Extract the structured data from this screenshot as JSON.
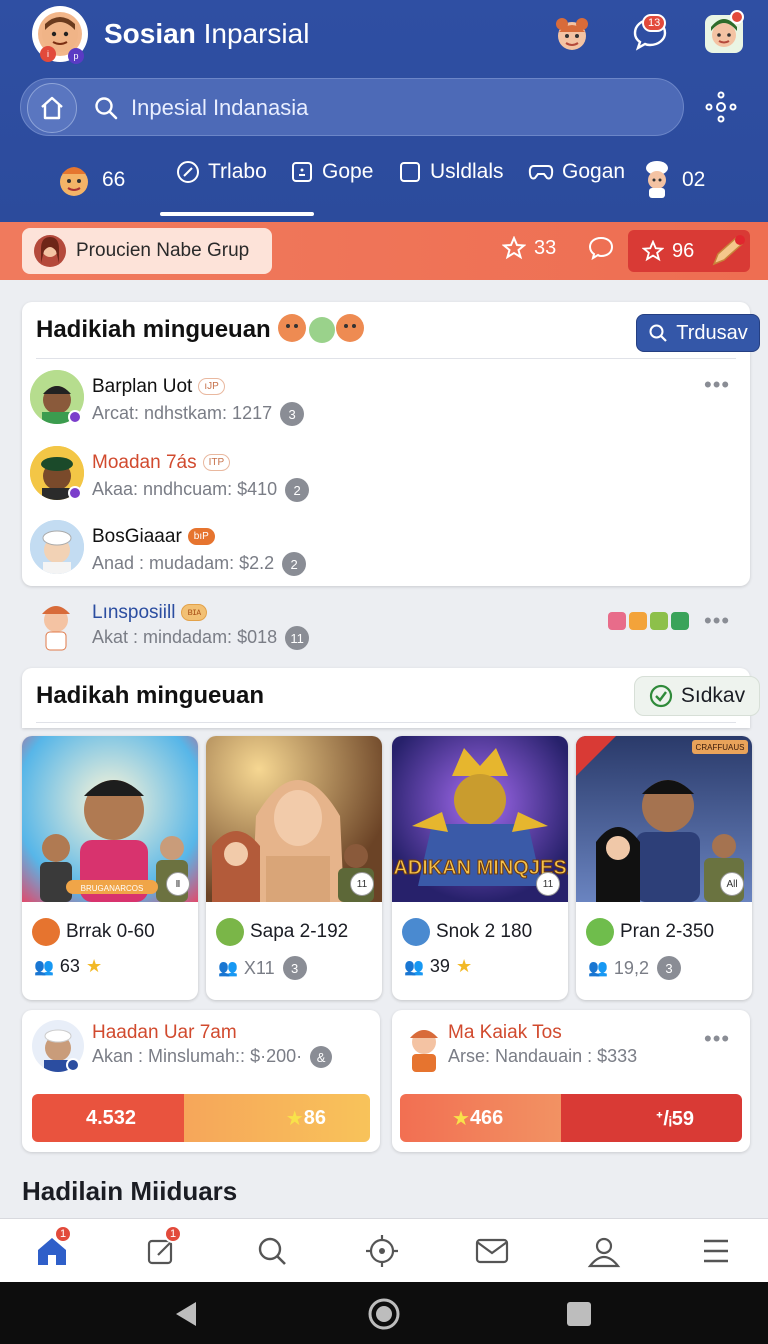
{
  "header": {
    "app_title_bold": "Sosian",
    "app_title_rest": " Inparsial",
    "logo_badges": [
      "i",
      "p"
    ],
    "messages_badge": "13",
    "search_placeholder": "Inpesial Indanasia",
    "colors": {
      "primary": "#2f4fa3",
      "accent": "#ee6e52",
      "danger": "#d93a35"
    }
  },
  "tabs": [
    {
      "label": "66",
      "icon": "mascot-icon"
    },
    {
      "label": "Trlabo",
      "icon": "edit-circle-icon",
      "active": true
    },
    {
      "label": "Gope",
      "icon": "square-dot-icon"
    },
    {
      "label": "Usldlals",
      "icon": "checkbox-icon"
    },
    {
      "label": "Gogan",
      "icon": "gamepad-icon"
    },
    {
      "label": "02",
      "icon": "chef-icon"
    }
  ],
  "group_bar": {
    "chip_label": "Proucien Nabe Grup",
    "stars": "33",
    "score": "96"
  },
  "leaderboard": {
    "title": "Hadikiah mingueuan",
    "button": "Trdusav",
    "rows": [
      {
        "name": "Barplan Uot",
        "tag": "ıJP",
        "sub": "Arcat: ndhstkam: 1217",
        "num": "3",
        "name_color": "#111111"
      },
      {
        "name": "Moadan 7ás",
        "tag": "ITP",
        "sub": "Akaa: nndhcuam: $410",
        "num": "2",
        "name_color": "#d14a2e"
      },
      {
        "name": "BosGiaaar",
        "tag": "bıP",
        "sub": "Anad : mudadam: $2.2",
        "num": "2",
        "name_color": "#111111"
      }
    ],
    "extra_row": {
      "name": "Lınsposiill",
      "tag": "ʙɪᴀ",
      "sub": "Akat : mindadam: $018",
      "num": "11"
    }
  },
  "featured": {
    "title": "Hadikah mingueuan",
    "button": "Sıdkav",
    "cards": [
      {
        "title": "Brrak 0-60",
        "stat": "63",
        "badge": "Ⅱ",
        "poster_text": "BRUGANARCOS"
      },
      {
        "title": "Sapa 2-192",
        "stat": "X11",
        "badge": "11",
        "poster_text": ""
      },
      {
        "title": "Snok 2 180",
        "stat": "39",
        "badge": "11",
        "poster_text": "HADIKAN MINQJESA"
      },
      {
        "title": "Pran 2-350",
        "stat": "19,2",
        "badge": "All",
        "poster_text": "CRAFFUAUS"
      }
    ]
  },
  "promos": [
    {
      "title": "Haadan Uar 7am",
      "sub": "Akan : Minslumah:: $·200·",
      "left_value": "4.532",
      "right_value": "86",
      "left_frac": 0.45
    },
    {
      "title": "Ma Kaiak Tos",
      "sub": "Arse: Nandauain : $333",
      "left_value": "466",
      "right_value": "ᐩ/ᵢ59",
      "left_frac": 0.47
    }
  ],
  "bottom_section_title": "Hadilain Miiduars",
  "navbar": {
    "items": [
      "home-icon",
      "compose-icon",
      "search-icon",
      "target-icon",
      "inbox-icon",
      "profile-icon",
      "menu-icon"
    ],
    "home_badge": "1",
    "compose_badge": "1"
  }
}
